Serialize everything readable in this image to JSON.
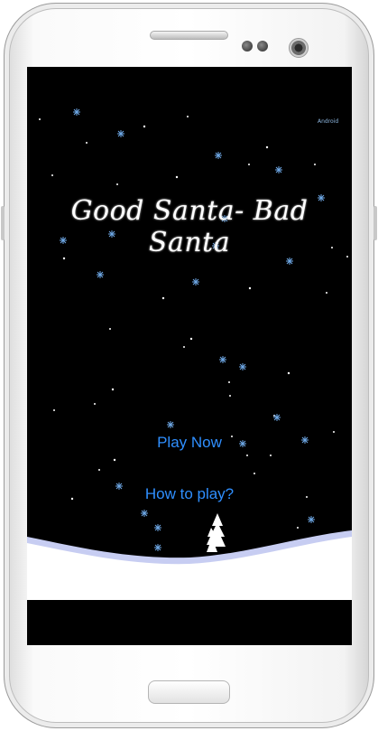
{
  "game": {
    "title": "Good Santa- Bad Santa",
    "corner_tag": "Android",
    "menu": {
      "play_label": "Play Now",
      "howto_label": "How to play?"
    }
  },
  "colors": {
    "sky": "#000000",
    "menu_text": "#2f8fff",
    "snowflake": "#6ea8e6",
    "snow": "#ffffff",
    "snow_shadow": "#c7cdf2"
  },
  "device": {
    "camera_icon": "camera-lens",
    "speaker_icon": "earpiece-grill",
    "home_icon": "home-button"
  }
}
